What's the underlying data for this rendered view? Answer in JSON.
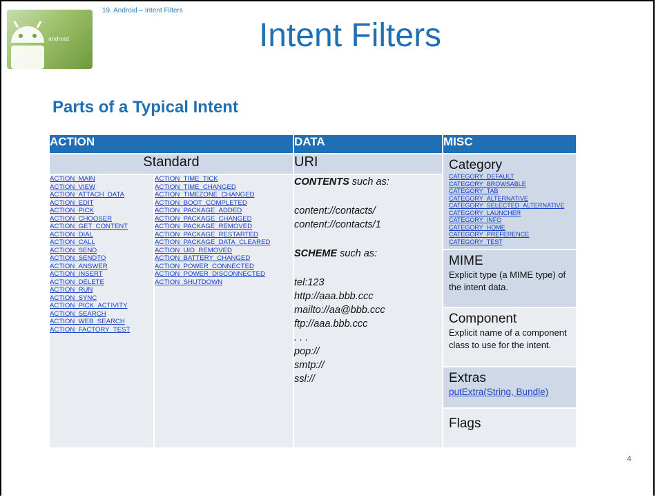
{
  "header": {
    "small_title": "19. Android – Intent Filters",
    "title": "Intent Filters",
    "logo_text": "android"
  },
  "section_title": "Parts of a Typical Intent",
  "table": {
    "headers": {
      "action": "ACTION",
      "data": "DATA",
      "misc": "MISC"
    },
    "action_sub": "Standard",
    "data_sub": "URI",
    "actions_col1": [
      "ACTION_MAIN",
      "ACTION_VIEW",
      "ACTION_ATTACH_DATA",
      "ACTION_EDIT",
      "ACTION_PICK",
      "ACTION_CHOOSER",
      "ACTION_GET_CONTENT",
      "ACTION_DIAL",
      "ACTION_CALL",
      "ACTION_SEND",
      "ACTION_SENDTO",
      "ACTION_ANSWER",
      "ACTION_INSERT",
      "ACTION_DELETE",
      "ACTION_RUN",
      "ACTION_SYNC",
      "ACTION_PICK_ACTIVITY",
      "ACTION_SEARCH",
      "ACTION_WEB_SEARCH",
      "ACTION_FACTORY_TEST"
    ],
    "actions_col2": [
      "ACTION_TIME_TICK",
      "ACTION_TIME_CHANGED",
      "ACTION_TIMEZONE_CHANGED",
      "ACTION_BOOT_COMPLETED",
      "ACTION_PACKAGE_ADDED",
      "ACTION_PACKAGE_CHANGED",
      "ACTION_PACKAGE_REMOVED",
      "ACTION_PACKAGE_RESTARTED",
      "ACTION_PACKAGE_DATA_CLEARED",
      "ACTION_UID_REMOVED",
      "ACTION_BATTERY_CHANGED",
      "ACTION_POWER_CONNECTED",
      "ACTION_POWER_DISCONNECTED",
      "ACTION_SHUTDOWN"
    ],
    "data": {
      "contents_label": "CONTENTS",
      "contents_suffix": " such as:",
      "contents_examples": [
        "content://contacts/",
        "content://contacts/1"
      ],
      "scheme_label": "SCHEME",
      "scheme_suffix": " such as:",
      "scheme_examples": [
        "tel:123",
        "http://aaa.bbb.ccc",
        "mailto://aa@bbb.ccc",
        "ftp://aaa.bbb.ccc",
        ". . .",
        "pop://",
        "smtp://",
        "ssl://"
      ]
    },
    "misc": {
      "category_head": "Category",
      "categories": [
        "CATEGORY_DEFAULT",
        "CATEGORY_BROWSABLE",
        "CATEGORY_TAB",
        "CATEGORY_ALTERNATIVE",
        "CATEGORY_SELECTED_ALTERNATIVE",
        "CATEGORY_LAUNCHER",
        "CATEGORY_INFO",
        "CATEGORY_HOME",
        "CATEGORY_PREFERENCE",
        "CATEGORY_TEST"
      ],
      "mime_head": "MIME",
      "mime_text": "Explicit  type (a MIME type) of the intent data.",
      "component_head": "Component",
      "component_text": "Explicit name of a component class to use for the intent.",
      "extras_head": "Extras",
      "extras_link": "putExtra(String, Bundle)",
      "flags_head": "Flags"
    }
  },
  "page_number": "4",
  "colors": {
    "accent": "#1f6fb5",
    "header_bg": "#1f6fb5",
    "sub_bg": "#cfd8e6",
    "cell_bg": "#e9ecf1",
    "link": "#1a3fc9"
  }
}
